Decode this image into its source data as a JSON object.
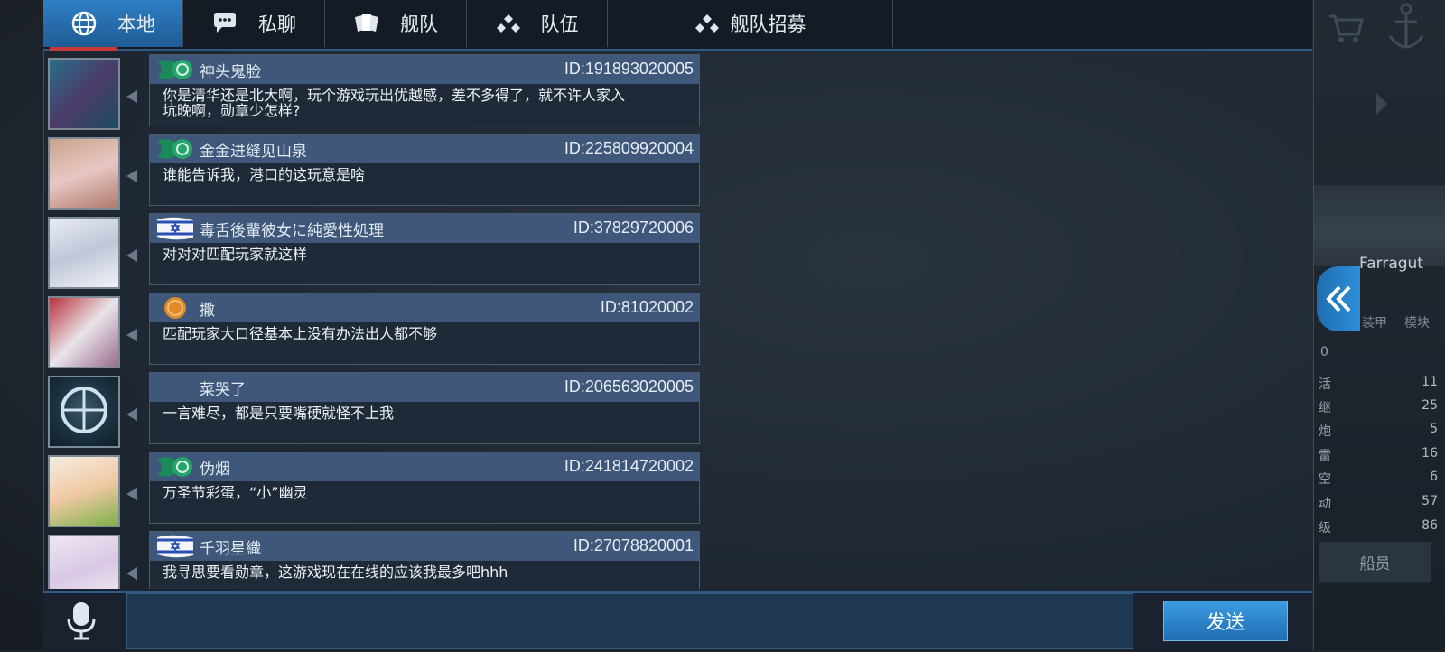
{
  "tabs": [
    {
      "label": "本地",
      "icon": "globe-icon",
      "active": true
    },
    {
      "label": "私聊",
      "icon": "chat-bubble-icon",
      "active": false
    },
    {
      "label": "舰队",
      "icon": "fleet-cards-icon",
      "active": false
    },
    {
      "label": "队伍",
      "icon": "team-dots-icon",
      "active": false
    },
    {
      "label": "舰队招募",
      "icon": "team-dots-icon",
      "active": false
    }
  ],
  "messages": [
    {
      "name": "神头鬼脸",
      "id": "ID:191893020005",
      "badge": "green-emblem",
      "text": "你是清华还是北大啊，玩个游戏玩出优越感，差不多得了，就不许人家入坑晚啊，勋章少怎样?"
    },
    {
      "name": "金金进缝见山泉",
      "id": "ID:225809920004",
      "badge": "green-emblem",
      "text": "谁能告诉我，港口的这玩意是啥"
    },
    {
      "name": "毒舌後輩彼女に純愛性処理",
      "id": "ID:37829720006",
      "badge": "israel-flag",
      "text": "对对对匹配玩家就这样"
    },
    {
      "name": "撒",
      "id": "ID:81020002",
      "badge": "orange-medal",
      "text": "匹配玩家大口径基本上没有办法出人都不够"
    },
    {
      "name": "菜哭了",
      "id": "ID:206563020005",
      "badge": "none",
      "text": "一言难尽，都是只要嘴硬就怪不上我"
    },
    {
      "name": "伪烟",
      "id": "ID:241814720002",
      "badge": "green-emblem",
      "text": "万圣节彩蛋，“小”幽灵"
    },
    {
      "name": "千羽星織",
      "id": "ID:27078820001",
      "badge": "israel-flag",
      "text": "我寻思要看勋章，这游戏现在在线的应该我最多吧hhh"
    }
  ],
  "send_label": "发送",
  "input_value": "",
  "background_panel": {
    "ship_name": "Farragut",
    "stats": [
      {
        "label": "活",
        "value": "11"
      },
      {
        "label": "继",
        "value": "25"
      },
      {
        "label": "炮",
        "value": "5"
      },
      {
        "label": "雷",
        "value": "16"
      },
      {
        "label": "空",
        "value": "6"
      },
      {
        "label": "动",
        "value": "57"
      },
      {
        "label": "级",
        "value": "86"
      }
    ],
    "side_labels": [
      "装甲",
      "模块"
    ],
    "zero": "0",
    "crew_label": "船员"
  },
  "colors": {
    "accent": "#2f7fc4",
    "send": "#2a86d0",
    "bubble_header": "#3e577a"
  }
}
